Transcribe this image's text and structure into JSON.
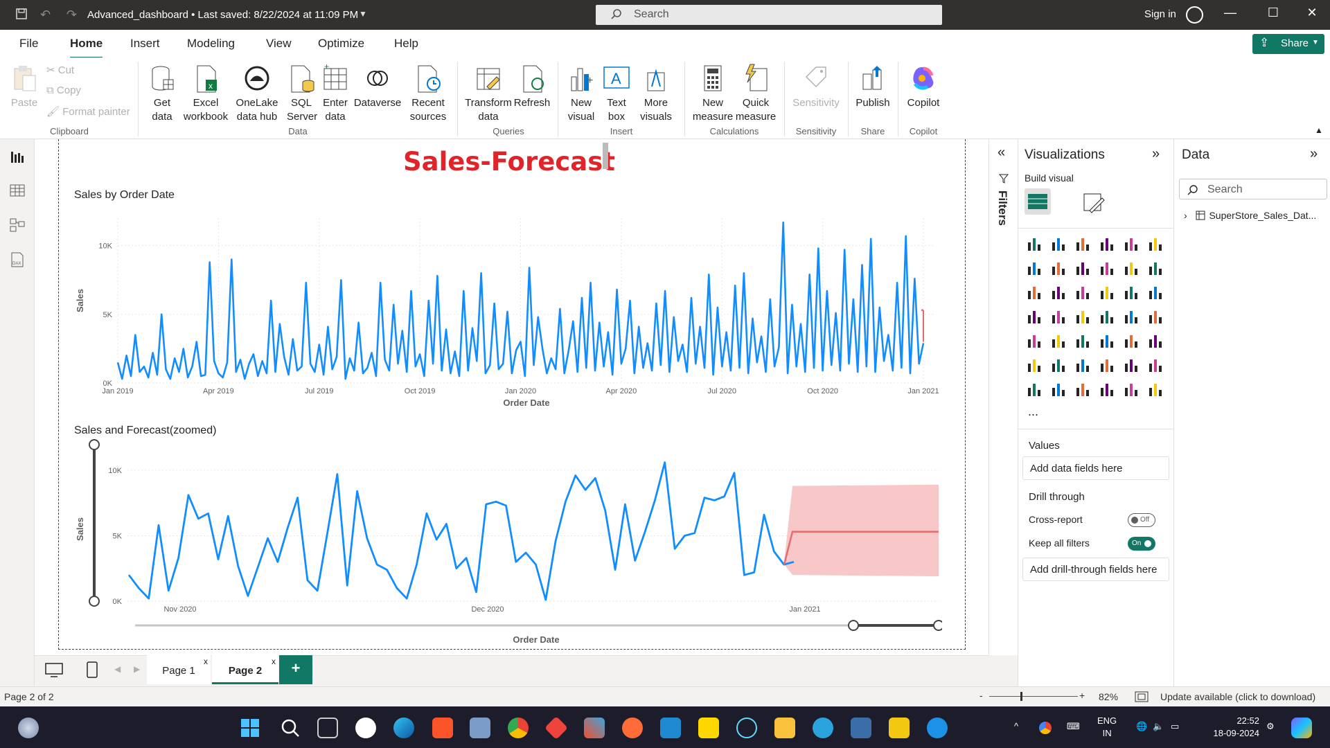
{
  "app": {
    "title": "Advanced_dashboard • Last saved: 8/22/2024 at 11:09 PM",
    "search_placeholder": "Search",
    "signin": "Sign in",
    "share": "Share"
  },
  "menu": [
    "File",
    "Home",
    "Insert",
    "Modeling",
    "View",
    "Optimize",
    "Help"
  ],
  "ribbon": {
    "clipboard": {
      "paste": "Paste",
      "cut": "Cut",
      "copy": "Copy",
      "format_painter": "Format painter",
      "group": "Clipboard"
    },
    "data": {
      "get_data": "Get data",
      "excel": "Excel workbook",
      "onelake": "OneLake data hub",
      "sql": "SQL Server",
      "enter": "Enter data",
      "dataverse": "Dataverse",
      "recent": "Recent sources",
      "group": "Data"
    },
    "queries": {
      "transform": "Transform data",
      "refresh": "Refresh",
      "group": "Queries"
    },
    "insert": {
      "new_visual": "New visual",
      "text_box": "Text box",
      "more_visuals": "More visuals",
      "group": "Insert"
    },
    "calculations": {
      "new_measure": "New measure",
      "quick_measure": "Quick measure",
      "group": "Calculations"
    },
    "sensitivity": {
      "label": "Sensitivity",
      "group": "Sensitivity"
    },
    "share": {
      "publish": "Publish",
      "group": "Share"
    },
    "copilot": {
      "label": "Copilot",
      "group": "Copilot"
    }
  },
  "report": {
    "title": "Sales-Forecast",
    "chart1_title": "Sales by Order Date",
    "chart2_title": "Sales and Forecast(zoomed)"
  },
  "chart_data": [
    {
      "type": "line",
      "title": "Sales by Order Date",
      "xlabel": "Order Date",
      "ylabel": "Sales",
      "x_ticks": [
        "Jan 2019",
        "Apr 2019",
        "Jul 2019",
        "Oct 2019",
        "Jan 2020",
        "Apr 2020",
        "Jul 2020",
        "Oct 2020",
        "Jan 2021"
      ],
      "y_ticks": [
        "0K",
        "5K",
        "10K"
      ],
      "ylim": [
        0,
        12000
      ],
      "series": [
        {
          "values": [
            1500,
            300,
            2000,
            500,
            3500,
            800,
            1200,
            400,
            2200,
            600,
            5000,
            1000,
            300,
            1800,
            800,
            2500,
            400,
            1200,
            3000,
            500,
            600,
            8800,
            1600,
            700,
            400,
            1500,
            9000,
            800,
            1700,
            300,
            1400,
            2100,
            500,
            1600,
            700,
            6000,
            800,
            4300,
            1900,
            600,
            3200,
            900,
            1200,
            7300,
            1400,
            800,
            2800,
            600,
            4100,
            1000,
            1900,
            7500,
            300,
            1800,
            900,
            4400,
            700,
            1100,
            2200,
            500,
            7300,
            1700,
            900,
            5700,
            1400,
            3800,
            800,
            6700,
            1200,
            2100,
            500,
            6000,
            1400,
            7800,
            900,
            3900,
            700,
            2300,
            500,
            6700,
            900,
            4000,
            1600,
            8000,
            700,
            1300,
            5800,
            1000,
            1400,
            5200,
            700,
            2400,
            3000,
            500,
            8400,
            1300,
            4800,
            2500,
            700,
            1800,
            1000,
            5400,
            700,
            2400,
            4500,
            800,
            6200,
            1100,
            7300,
            900,
            4400,
            1200,
            3700,
            600,
            6800,
            1400,
            2500,
            6000,
            700,
            4100,
            1100,
            2900,
            900,
            5800,
            1300,
            6700,
            800,
            4800,
            1600,
            2800,
            800,
            6200,
            1400,
            4100,
            1100,
            7900,
            600,
            5500,
            1200,
            3700,
            900,
            7100,
            1100,
            8000,
            700,
            4700,
            1500,
            3400,
            800,
            6100,
            1200,
            2600,
            11700,
            700,
            5700,
            1200,
            4300,
            800,
            7900,
            1100,
            9800,
            900,
            6700,
            1300,
            5100,
            900,
            9700,
            1400,
            6100,
            800,
            8600,
            1200,
            10500,
            800,
            5500,
            1600,
            3500,
            900,
            7300,
            1100,
            10700,
            700,
            7600,
            1400,
            2900
          ]
        },
        {
          "name": "Forecast",
          "values": [
            5300
          ]
        }
      ]
    },
    {
      "type": "line",
      "title": "Sales and Forecast(zoomed)",
      "xlabel": "Order Date",
      "ylabel": "Sales",
      "x_ticks": [
        "Nov 2020",
        "Dec 2020",
        "Jan 2021"
      ],
      "y_ticks": [
        "0K",
        "5K",
        "10K"
      ],
      "ylim": [
        0,
        11000
      ],
      "series": [
        {
          "name": "Sales",
          "values": [
            2000,
            1000,
            200,
            5800,
            800,
            3300,
            8100,
            6300,
            6700,
            3200,
            6500,
            2700,
            400,
            2600,
            4800,
            3000,
            5600,
            7900,
            1600,
            800,
            5200,
            9700,
            1200,
            8400,
            4800,
            2800,
            2400,
            1000,
            200,
            2800,
            6700,
            4700,
            5900,
            2500,
            3300,
            700,
            7400,
            7600,
            7300,
            3000,
            3700,
            2800,
            100,
            4600,
            7600,
            9600,
            8500,
            9400,
            6900,
            2400,
            7400,
            3100,
            5300,
            7700,
            10600,
            4000,
            5000,
            5200,
            7900,
            7700,
            8000,
            9800,
            2000,
            2200,
            6600,
            3800,
            2800,
            3000
          ]
        },
        {
          "name": "Forecast",
          "values": [
            5300,
            5300,
            5300,
            5300,
            5300
          ]
        }
      ],
      "forecast_band": {
        "lower": 2000,
        "upper": 8800
      }
    }
  ],
  "visualizations": {
    "title": "Visualizations",
    "build_visual": "Build visual",
    "values_label": "Values",
    "values_placeholder": "Add data fields here",
    "drill_through": "Drill through",
    "cross_report": "Cross-report",
    "cross_report_state": "Off",
    "keep_filters": "Keep all filters",
    "keep_filters_state": "On",
    "drill_placeholder": "Add drill-through fields here",
    "more": "..."
  },
  "filters": {
    "label": "Filters"
  },
  "data_pane": {
    "title": "Data",
    "search_placeholder": "Search",
    "table": "SuperStore_Sales_Dat..."
  },
  "pages": {
    "page1": "Page 1",
    "page2": "Page 2",
    "close": "x",
    "add": "+"
  },
  "status": {
    "page": "Page 2 of 2",
    "zoom": "82%",
    "update": "Update available (click to download)",
    "zoom_minus": "-",
    "zoom_plus": "+"
  },
  "taskbar": {
    "lang1": "ENG",
    "lang2": "IN",
    "time": "22:52",
    "date": "18-09-2024"
  },
  "colors": {
    "accent": "#117865",
    "sales": "#118DFF",
    "forecast": "#E66C37",
    "band": "#F8C8C8",
    "title": "#E0242A"
  }
}
